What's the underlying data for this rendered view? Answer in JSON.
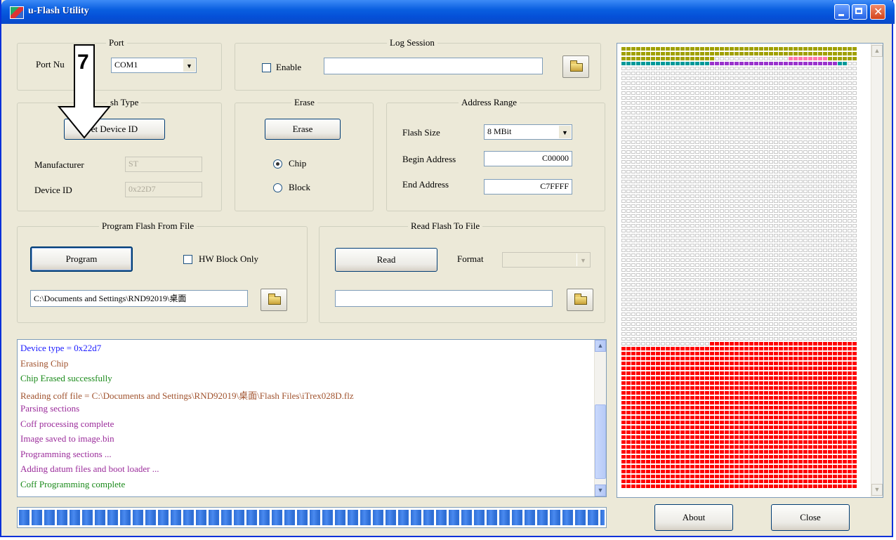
{
  "window": {
    "title": "u-Flash Utility"
  },
  "port": {
    "legend": "Port",
    "number_label": "Port Nu",
    "selected": "COM1"
  },
  "log_session": {
    "legend": "Log Session",
    "enable_label": "Enable",
    "path_value": ""
  },
  "flash_type": {
    "legend": "sh Type",
    "get_id_button": "et Device ID",
    "manufacturer_label": "Manufacturer",
    "manufacturer_value": "ST",
    "device_id_label": "Device ID",
    "device_id_value": "0x22D7"
  },
  "erase": {
    "legend": "Erase",
    "erase_button": "Erase",
    "chip_label": "Chip",
    "block_label": "Block",
    "selected": "Chip"
  },
  "address_range": {
    "legend": "Address Range",
    "flash_size_label": "Flash Size",
    "flash_size_value": "8 MBit",
    "begin_label": "Begin Address",
    "begin_value": "C00000",
    "end_label": "End Address",
    "end_value": "C7FFFF"
  },
  "program": {
    "legend": "Program Flash From File",
    "program_button": "Program",
    "hw_block_label": "HW Block Only",
    "file_path": "C:\\Documents and Settings\\RND92019\\桌面"
  },
  "read": {
    "legend": "Read Flash To File",
    "read_button": "Read",
    "format_label": "Format",
    "format_value": "",
    "file_path": ""
  },
  "log": {
    "lines": [
      {
        "text": "Device type = 0x22d7",
        "color": "#1a1aff"
      },
      {
        "text": "Erasing Chip",
        "color": "#a0522d"
      },
      {
        "text": "Chip Erased successfully",
        "color": "#1a8a1a"
      },
      {
        "text": "Reading coff file = C:\\Documents and Settings\\RND92019\\桌面\\Flash Files\\iTrex028D.flz",
        "color": "#a0522d"
      },
      {
        "text": "Parsing sections",
        "color": "#9b2c9b"
      },
      {
        "text": "Coff processing complete",
        "color": "#9b2c9b"
      },
      {
        "text": "Image saved to image.bin",
        "color": "#9b2c9b"
      },
      {
        "text": "Programming sections ...",
        "color": "#9b2c9b"
      },
      {
        "text": "Adding datum files and boot loader ...",
        "color": "#9b2c9b"
      },
      {
        "text": "Coff Programming complete",
        "color": "#1a8a1a"
      }
    ]
  },
  "progress": {
    "fraction": 1.0
  },
  "buttons": {
    "about": "About",
    "close": "Close"
  },
  "overlay": {
    "step_number": "7"
  },
  "block_map": {
    "colors": {
      "olive": "#a0a000",
      "teal": "#009999",
      "purple": "#9933cc",
      "pink": "#ff77aa",
      "red": "#ff0000"
    }
  }
}
